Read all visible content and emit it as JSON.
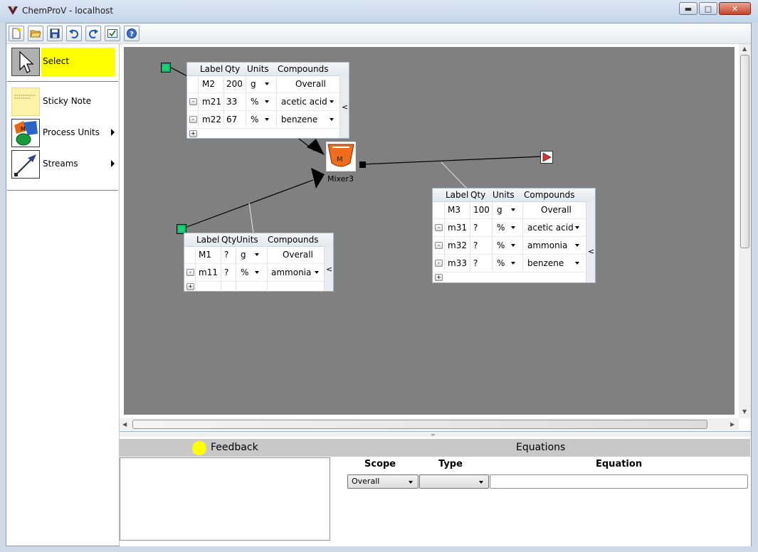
{
  "window": {
    "title": "ChemProV - localhost"
  },
  "toolbar": {
    "buttons": [
      "new-file-icon",
      "open-folder-icon",
      "save-icon",
      "undo-icon",
      "redo-icon",
      "check-icon",
      "help-icon"
    ]
  },
  "palette": {
    "items": [
      {
        "name": "select",
        "label": "Select",
        "highlight": "#ffff00"
      },
      {
        "name": "sticky-note",
        "label": "Sticky Note"
      },
      {
        "name": "process-units",
        "label": "Process Units"
      },
      {
        "name": "streams",
        "label": "Streams"
      }
    ]
  },
  "canvas": {
    "background": "#808080",
    "mixer": {
      "label": "Mixer3",
      "glyph": "M",
      "color": "#f26a1b"
    },
    "table_headers": {
      "label": "Label",
      "qty": "Qty",
      "units": "Units",
      "compounds": "Compounds"
    },
    "collapse_glyph": "<",
    "tables": [
      {
        "name": "M2",
        "rows": [
          {
            "label": "M2",
            "qty": "200",
            "units": "g",
            "compound": "Overall"
          },
          {
            "label": "m21",
            "qty": "33",
            "units": "%",
            "compound": "acetic acid"
          },
          {
            "label": "m22",
            "qty": "67",
            "units": "%",
            "compound": "benzene"
          }
        ]
      },
      {
        "name": "M1",
        "rows": [
          {
            "label": "M1",
            "qty": "?",
            "units": "g",
            "compound": "Overall"
          },
          {
            "label": "m11",
            "qty": "?",
            "units": "%",
            "compound": "ammonia"
          }
        ]
      },
      {
        "name": "M3",
        "rows": [
          {
            "label": "M3",
            "qty": "100",
            "units": "g",
            "compound": "Overall"
          },
          {
            "label": "m31",
            "qty": "?",
            "units": "%",
            "compound": "acetic acid"
          },
          {
            "label": "m32",
            "qty": "?",
            "units": "%",
            "compound": "ammonia"
          },
          {
            "label": "m33",
            "qty": "?",
            "units": "%",
            "compound": "benzene"
          }
        ]
      }
    ]
  },
  "feedback": {
    "title": "Feedback",
    "light_color": "#ffff00"
  },
  "equations": {
    "title": "Equations",
    "columns": {
      "scope": "Scope",
      "type": "Type",
      "equation": "Equation"
    },
    "scope_value": "Overall",
    "type_value": "",
    "equation_value": ""
  }
}
